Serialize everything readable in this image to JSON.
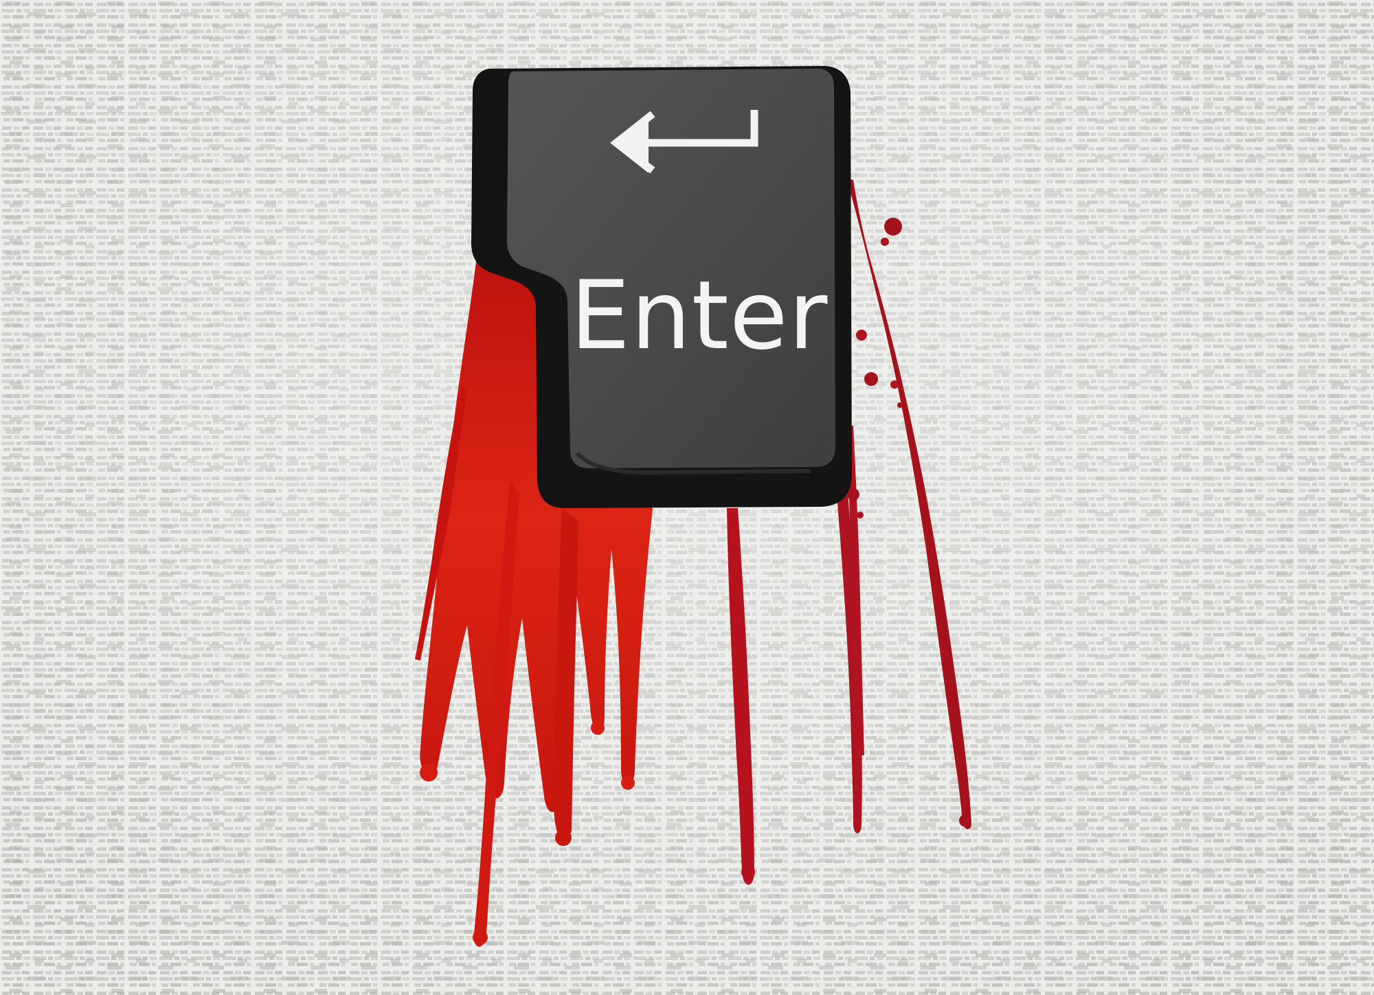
{
  "key": {
    "label": "Enter",
    "icon": "return-arrow-icon"
  },
  "colors": {
    "background": "#ececea",
    "key_top": "#4a4a4a",
    "key_body": "#141414",
    "key_label": "#f4f4f4",
    "blood_bright": "#d51d12",
    "blood_dark": "#a5121c"
  }
}
